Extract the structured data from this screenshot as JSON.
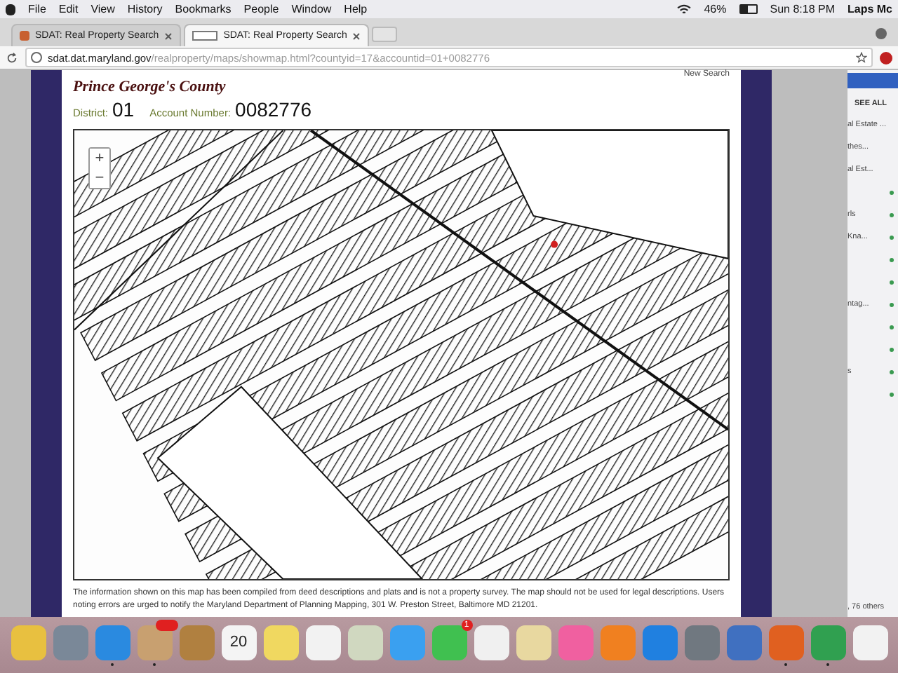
{
  "menu_bar": {
    "items": [
      "File",
      "Edit",
      "View",
      "History",
      "Bookmarks",
      "People",
      "Window",
      "Help"
    ],
    "battery": "46%",
    "clock": "Sun 8:18 PM",
    "user": "Laps Mc"
  },
  "tabs": [
    {
      "label": "SDAT: Real Property Search",
      "selected": false
    },
    {
      "label": "SDAT: Real Property Search",
      "selected": true
    }
  ],
  "address_bar": {
    "host": "sdat.dat.maryland.gov",
    "path": "/realproperty/maps/showmap.html?countyid=17&accountid=01+0082776"
  },
  "page": {
    "new_search": "New Search",
    "county": "Prince George's County",
    "district_label": "District:",
    "district": "01",
    "account_label": "Account Number:",
    "account": "0082776",
    "zoom_controls": [
      "+",
      "−"
    ],
    "disclaimer": "The information shown on this map has been compiled from deed descriptions and plats and is not a property survey. The map should not be used for legal descriptions. Users noting errors are urged to notify the Maryland Department of Planning Mapping, 301 W. Preston Street, Baltimore MD 21201."
  },
  "side_panel": {
    "header": "SEE ALL",
    "items": [
      {
        "text": "al Estate ...",
        "dot": false
      },
      {
        "text": "thes...",
        "dot": false
      },
      {
        "text": "al Est...",
        "dot": false
      },
      {
        "dot": true
      },
      {
        "text": "rls",
        "dot": true
      },
      {
        "text": "Kna...",
        "dot": true
      },
      {
        "dot": true
      },
      {
        "dot": true
      },
      {
        "text": "ntag...",
        "dot": true
      },
      {
        "dot": true
      },
      {
        "dot": true
      },
      {
        "text": "s",
        "dot": true
      },
      {
        "dot": true
      }
    ],
    "footer": ", 76 others"
  },
  "dock": {
    "items": [
      {
        "color": "#e8c040",
        "running": false
      },
      {
        "color": "#7a8898",
        "running": false
      },
      {
        "color": "#2a8ae0",
        "running": true
      },
      {
        "color": "#c8a070",
        "running": true,
        "badge": true
      },
      {
        "color": "#b08040",
        "running": false
      },
      {
        "color": "#f4f4f4",
        "running": false,
        "date": "20"
      },
      {
        "color": "#f0d860",
        "running": false
      },
      {
        "color": "#f2f2f2",
        "running": false
      },
      {
        "color": "#d0d8c0",
        "running": false
      },
      {
        "color": "#3aa0f0",
        "running": false
      },
      {
        "color": "#40c050",
        "running": false,
        "count": "1"
      },
      {
        "color": "#f0f0f0",
        "running": false
      },
      {
        "color": "#e8d8a0",
        "running": false
      },
      {
        "color": "#f060a0",
        "running": false
      },
      {
        "color": "#f08020",
        "running": false
      },
      {
        "color": "#2080e0",
        "running": false
      },
      {
        "color": "#707880",
        "running": false
      },
      {
        "color": "#4070c0",
        "running": false
      },
      {
        "color": "#e06020",
        "running": true
      },
      {
        "color": "#30a050",
        "running": true
      },
      {
        "color": "#f2f2f2",
        "running": false
      }
    ]
  }
}
